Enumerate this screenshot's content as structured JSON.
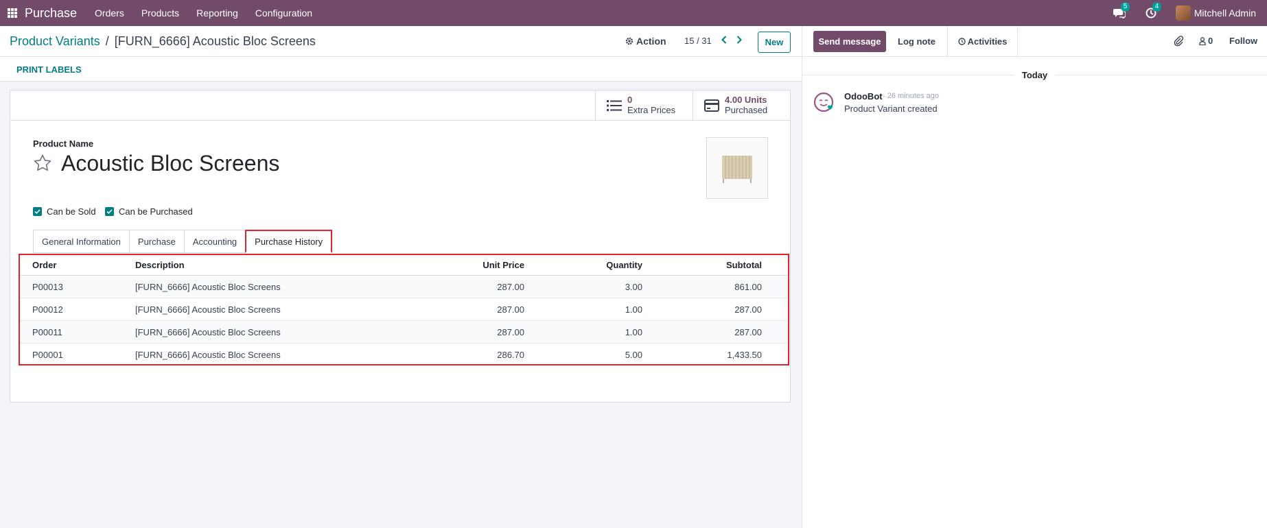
{
  "navbar": {
    "app_name": "Purchase",
    "menu": [
      "Orders",
      "Products",
      "Reporting",
      "Configuration"
    ],
    "messages_count": "5",
    "activities_count": "4",
    "user_name": "Mitchell Admin",
    "bg_color": "#714b67"
  },
  "control": {
    "breadcrumb_parent": "Product Variants",
    "breadcrumb_sep": "/",
    "breadcrumb_current": "[FURN_6666] Acoustic Bloc Screens",
    "action_label": "Action",
    "pager": "15 / 31",
    "new_label": "New"
  },
  "print_labels": "PRINT LABELS",
  "stats": {
    "extra_prices_value": "0",
    "extra_prices_label": "Extra Prices",
    "purchased_value": "4.00 Units",
    "purchased_label": "Purchased"
  },
  "form": {
    "product_name_label": "Product Name",
    "product_name": "Acoustic Bloc Screens",
    "can_be_sold": "Can be Sold",
    "can_be_purchased": "Can be Purchased"
  },
  "tabs": [
    "General Information",
    "Purchase",
    "Accounting",
    "Purchase History"
  ],
  "history": {
    "headers": {
      "order": "Order",
      "description": "Description",
      "unit_price": "Unit Price",
      "quantity": "Quantity",
      "subtotal": "Subtotal"
    },
    "rows": [
      {
        "order": "P00013",
        "description": "[FURN_6666] Acoustic Bloc Screens",
        "unit_price": "287.00",
        "quantity": "3.00",
        "subtotal": "861.00"
      },
      {
        "order": "P00012",
        "description": "[FURN_6666] Acoustic Bloc Screens",
        "unit_price": "287.00",
        "quantity": "1.00",
        "subtotal": "287.00"
      },
      {
        "order": "P00011",
        "description": "[FURN_6666] Acoustic Bloc Screens",
        "unit_price": "287.00",
        "quantity": "1.00",
        "subtotal": "287.00"
      },
      {
        "order": "P00001",
        "description": "[FURN_6666] Acoustic Bloc Screens",
        "unit_price": "286.70",
        "quantity": "5.00",
        "subtotal": "1,433.50"
      }
    ]
  },
  "chatter": {
    "send_message": "Send message",
    "log_note": "Log note",
    "activities": "Activities",
    "followers_count": "0",
    "follow": "Follow",
    "today": "Today",
    "message": {
      "author": "OdooBot",
      "time": "- 26 minutes ago",
      "body": "Product Variant created"
    }
  }
}
